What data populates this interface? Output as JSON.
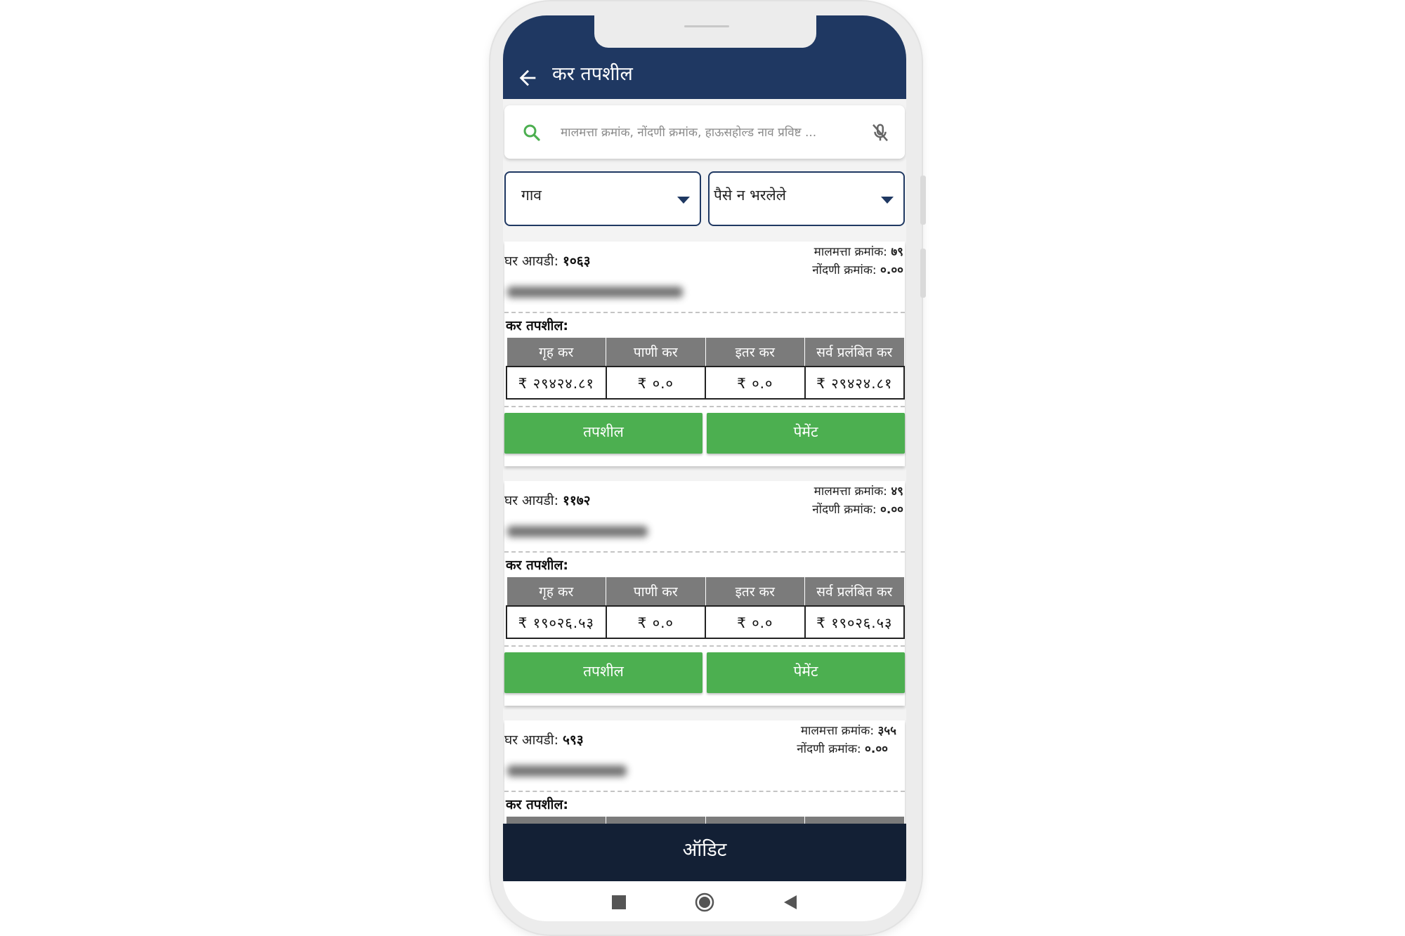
{
  "app": {
    "title": "कर तपशील",
    "search_placeholder": "मालमत्ता क्रमांक, नोंदणी क्रमांक, हाऊसहोल्ड नाव प्रविष्ट ...",
    "filters": {
      "village": "गाव",
      "payment_status": "पैसे न भरलेले"
    },
    "bottom_button": "ऑडिट"
  },
  "labels": {
    "house_id": "घर आयडी:",
    "property_no": "मालमत्ता क्रमांक:",
    "registration_no": "नोंदणी क्रमांक:",
    "tax_details": "कर तपशील:",
    "col_house_tax": "गृह कर",
    "col_water_tax": "पाणी कर",
    "col_other_tax": "इतर कर",
    "col_total_pending": "सर्व प्रलंबित कर",
    "details_button": "तपशील",
    "payment_button": "पेमेंट"
  },
  "records": [
    {
      "house_id": "१०६३",
      "property_no": "७९",
      "registration_no": "०.००",
      "house_tax": "₹ २९४२४.८१",
      "water_tax": "₹ ०.०",
      "other_tax": "₹ ०.०",
      "total_pending": "₹ २९४२४.८१"
    },
    {
      "house_id": "११७२",
      "property_no": "४९",
      "registration_no": "०.००",
      "house_tax": "₹ १९०२६.५३",
      "water_tax": "₹ ०.०",
      "other_tax": "₹ ०.०",
      "total_pending": "₹ १९०२६.५३"
    },
    {
      "house_id": "५९३",
      "property_no": "३५५",
      "registration_no": "०.००"
    }
  ],
  "colors": {
    "appbar": "#1f3862",
    "button_green": "#4caf50",
    "bottom_bar": "#132035",
    "table_header": "#7b7b7b"
  }
}
